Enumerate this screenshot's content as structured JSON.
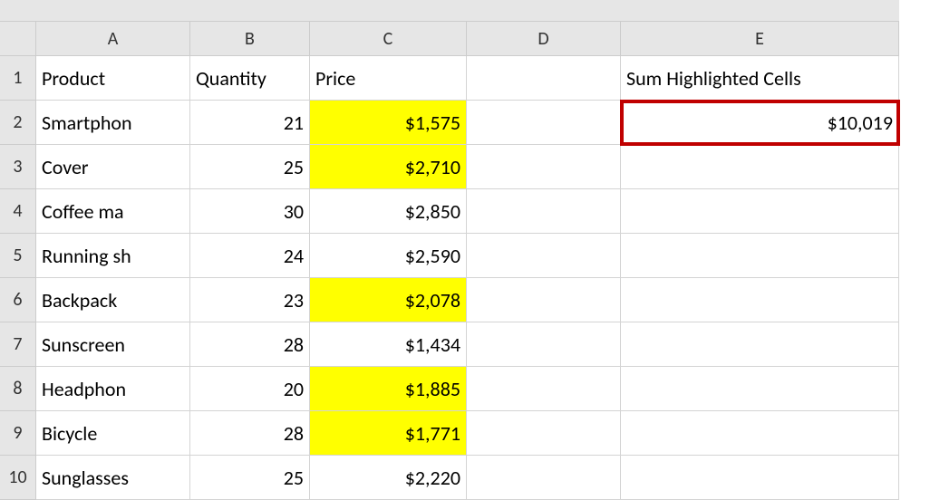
{
  "columns": [
    "A",
    "B",
    "C",
    "D",
    "E"
  ],
  "rowNumbers": [
    "1",
    "2",
    "3",
    "4",
    "5",
    "6",
    "7",
    "8",
    "9",
    "10"
  ],
  "headers": {
    "A": "Product",
    "B": "Quantity",
    "C": "Price",
    "E": "Sum Highlighted Cells"
  },
  "data": [
    {
      "product": "Smartphon",
      "quantity": "21",
      "price": "$1,575",
      "highlighted": true
    },
    {
      "product": "Cover",
      "quantity": "25",
      "price": "$2,710",
      "highlighted": true
    },
    {
      "product": "Coffee ma",
      "quantity": "30",
      "price": "$2,850",
      "highlighted": false
    },
    {
      "product": "Running sh",
      "quantity": "24",
      "price": "$2,590",
      "highlighted": false
    },
    {
      "product": "Backpack",
      "quantity": "23",
      "price": "$2,078",
      "highlighted": true
    },
    {
      "product": "Sunscreen",
      "quantity": "28",
      "price": "$1,434",
      "highlighted": false
    },
    {
      "product": "Headphon",
      "quantity": "20",
      "price": "$1,885",
      "highlighted": true
    },
    {
      "product": "Bicycle",
      "quantity": "28",
      "price": "$1,771",
      "highlighted": true
    },
    {
      "product": "Sunglasses",
      "quantity": "25",
      "price": "$2,220",
      "highlighted": false
    }
  ],
  "result": {
    "label": "$10,019"
  },
  "chart_data": {
    "type": "table",
    "columns": [
      "Product",
      "Quantity",
      "Price",
      "Highlighted"
    ],
    "rows": [
      [
        "Smartphone",
        21,
        1575,
        true
      ],
      [
        "Cover",
        25,
        2710,
        true
      ],
      [
        "Coffee maker",
        30,
        2850,
        false
      ],
      [
        "Running shoes",
        24,
        2590,
        false
      ],
      [
        "Backpack",
        23,
        2078,
        true
      ],
      [
        "Sunscreen",
        28,
        1434,
        false
      ],
      [
        "Headphones",
        20,
        1885,
        true
      ],
      [
        "Bicycle",
        28,
        1771,
        true
      ],
      [
        "Sunglasses",
        25,
        2220,
        false
      ]
    ],
    "sum_highlighted": 10019,
    "title": "Sum Highlighted Cells"
  }
}
